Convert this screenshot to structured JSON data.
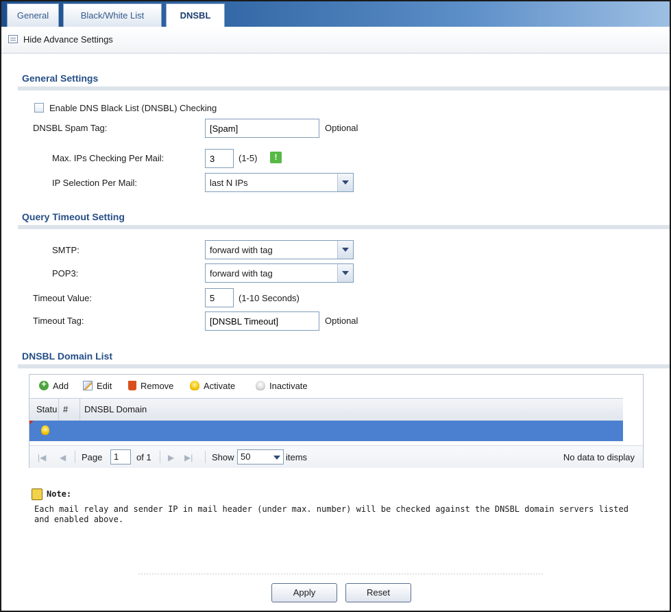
{
  "tabs": [
    {
      "label": "General",
      "active": false
    },
    {
      "label": "Black/White List",
      "active": false
    },
    {
      "label": "DNSBL",
      "active": true
    }
  ],
  "advanced_toggle": "Hide Advance Settings",
  "general": {
    "title": "General Settings",
    "enable_label": "Enable DNS Black List (DNSBL) Checking",
    "enable_checked": false,
    "spam_tag_label": "DNSBL Spam Tag:",
    "spam_tag_value": "[Spam]",
    "spam_tag_hint": "Optional",
    "max_ips_label": "Max. IPs Checking Per Mail:",
    "max_ips_value": "3",
    "max_ips_hint": "(1-5)",
    "ip_selection_label": "IP Selection Per Mail:",
    "ip_selection_value": "last N IPs"
  },
  "query": {
    "title": "Query Timeout Setting",
    "smtp_label": "SMTP:",
    "smtp_value": "forward with tag",
    "pop3_label": "POP3:",
    "pop3_value": "forward with tag",
    "timeout_label": "Timeout Value:",
    "timeout_value": "5",
    "timeout_hint": "(1-10 Seconds)",
    "tag_label": "Timeout Tag:",
    "tag_value": "[DNSBL Timeout]",
    "tag_hint": "Optional"
  },
  "domain_list": {
    "title": "DNSBL Domain List",
    "toolbar": {
      "add": "Add",
      "edit": "Edit",
      "remove": "Remove",
      "activate": "Activate",
      "inactivate": "Inactivate"
    },
    "columns": {
      "status": "Statu",
      "num": "#",
      "domain": "DNSBL Domain"
    },
    "pager": {
      "page": "Page",
      "page_value": "1",
      "of": "of 1",
      "show": "Show",
      "show_value": "50",
      "items": "items",
      "empty": "No data to display"
    }
  },
  "note": {
    "title": "Note:",
    "text": "Each mail relay and sender IP in mail header (under max. number) will be checked against the DNSBL domain servers listed and enabled above."
  },
  "buttons": {
    "apply": "Apply",
    "reset": "Reset"
  }
}
